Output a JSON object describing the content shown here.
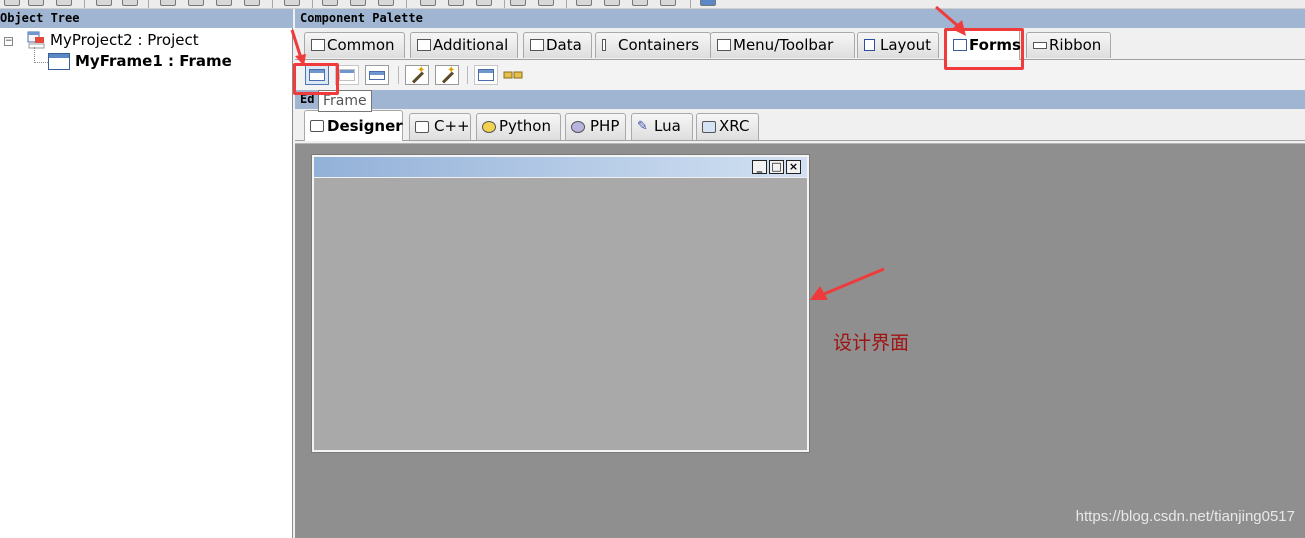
{
  "object_tree": {
    "title": "Object Tree",
    "project_label": "MyProject2 : Project",
    "frame_label": "MyFrame1 : Frame",
    "expander": "−"
  },
  "palette": {
    "title": "Component Palette",
    "tabs": [
      {
        "label": "Common",
        "icon": "ok-button-icon"
      },
      {
        "label": "Additional",
        "icon": "additional-icon"
      },
      {
        "label": "Data",
        "icon": "grid-icon"
      },
      {
        "label": "Containers",
        "icon": "container-icon"
      },
      {
        "label": "Menu/Toolbar",
        "icon": "menu-icon"
      },
      {
        "label": "Layout",
        "icon": "layout-icon"
      },
      {
        "label": "Forms",
        "icon": "frame-icon"
      },
      {
        "label": "Ribbon",
        "icon": "ribbon-icon"
      }
    ],
    "active_tab": "Forms",
    "tools": [
      "frame-tool",
      "panel-tool",
      "dialog-tool",
      "wizard-tool",
      "wizard-page-tool",
      "menubar-tool",
      "toolbar-tool"
    ],
    "tooltip": "Frame"
  },
  "editor": {
    "title": "Ed",
    "tabs": [
      {
        "label": "Designer",
        "icon": "designer-icon"
      },
      {
        "label": "C++",
        "icon": "cpp-icon"
      },
      {
        "label": "Python",
        "icon": "python-icon"
      },
      {
        "label": "PHP",
        "icon": "php-icon"
      },
      {
        "label": "Lua",
        "icon": "lua-icon"
      },
      {
        "label": "XRC",
        "icon": "xrc-icon"
      }
    ],
    "active_tab": "Designer",
    "window_buttons": {
      "minimize": "_",
      "maximize": "□",
      "close": "×"
    }
  },
  "annotation": {
    "text": "设计界面",
    "color": "#ef3b3b"
  },
  "watermark": "https://blog.csdn.net/tianjing0517"
}
